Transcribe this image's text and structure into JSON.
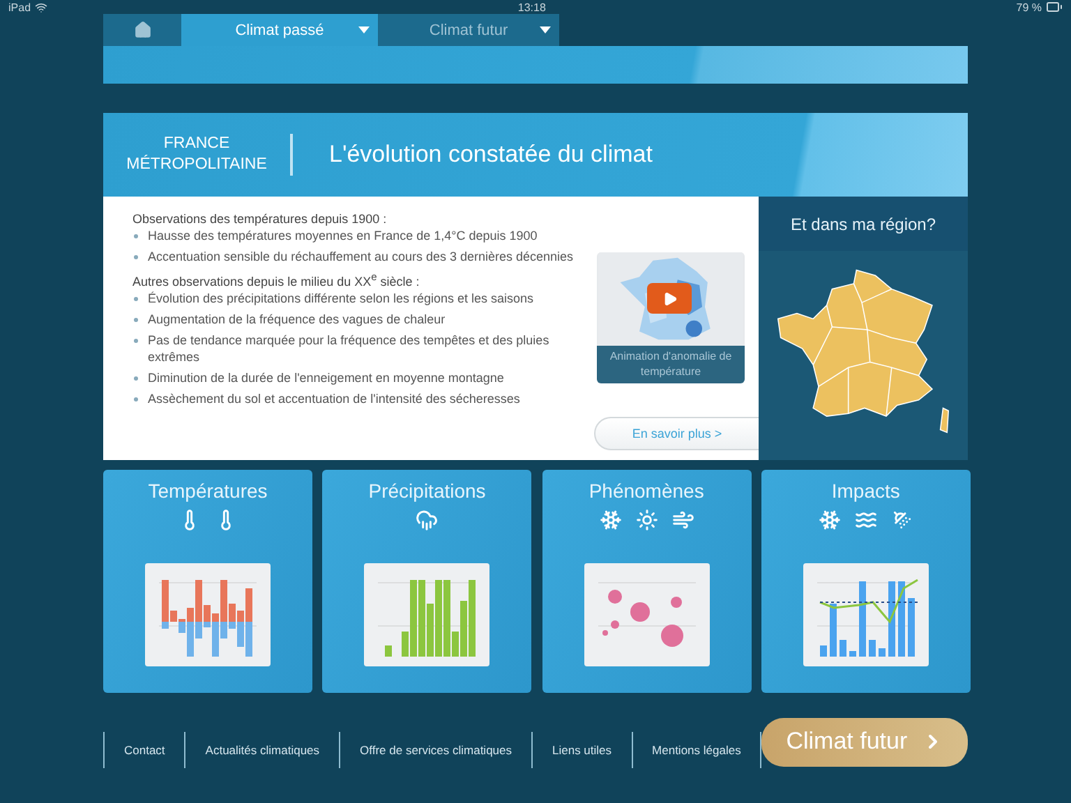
{
  "status_bar": {
    "device": "iPad",
    "time": "13:18",
    "battery": "79 %"
  },
  "tabs": [
    {
      "kind": "home",
      "selected": false
    },
    {
      "kind": "menu",
      "label": "Climat passé",
      "selected": true
    },
    {
      "kind": "menu",
      "label": "Climat futur",
      "selected": false
    }
  ],
  "panel": {
    "region": [
      "FRANCE",
      "MÉTROPOLITAINE"
    ],
    "title": "L'évolution constatée du climat",
    "sections": [
      {
        "heading": "Observations des températures depuis 1900 :",
        "items": [
          "Hausse des températures moyennes en France de 1,4°C depuis 1900",
          "Accentuation sensible du réchauffement au cours des 3 dernières décennies"
        ]
      },
      {
        "heading": "Autres observations depuis le milieu du XX$^{e}$ siècle :",
        "items": [
          "Évolution des précipitations différente selon les régions et les saisons",
          "Augmentation de la fréquence des vagues de chaleur",
          "Pas de tendance marquée pour la fréquence des tempêtes et des pluies extrêmes",
          "Diminution de la durée de l'enneigement en moyenne montagne",
          "Assèchement du sol et accentuation de l'intensité des sécheresses"
        ]
      }
    ],
    "video_caption": "Animation d'anomalie de température",
    "more_button": "En savoir plus >"
  },
  "region_panel": {
    "title": "Et dans ma région?"
  },
  "cards": [
    {
      "title": "Températures",
      "kind": "temperatures"
    },
    {
      "title": "Précipitations",
      "kind": "precipitations"
    },
    {
      "title": "Phénomènes",
      "kind": "phenomena"
    },
    {
      "title": "Impacts",
      "kind": "impacts"
    }
  ],
  "footer": {
    "links": [
      "Contact",
      "Actualités climatiques",
      "Offre de services climatiques",
      "Liens utiles",
      "Mentions légales"
    ],
    "button": "Climat futur"
  }
}
